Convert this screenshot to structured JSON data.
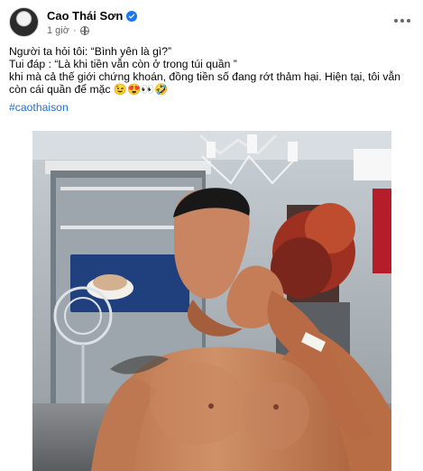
{
  "post": {
    "author": "Cao Thái Sơn",
    "time": "1 giờ",
    "lines": [
      "Người ta hỏi tôi: “Bình yên là gì?”",
      "Tui đáp : “Là khi tiền vẫn còn ở trong túi quần ”",
      "khi mà cả thế giới chứng khoán, đồng tiền số đang rớt thảm hại. Hiện tại, tôi vẫn còn cái quần để mặc 😉😍👀🤣"
    ],
    "hashtag": "#caothaison"
  },
  "icons": {
    "verified": "verified-badge-icon",
    "privacy": "globe-icon",
    "more": "more-options-icon"
  },
  "colors": {
    "accent": "#1877f2",
    "hashtag": "#216fdb",
    "background_side": "#c9a793"
  }
}
